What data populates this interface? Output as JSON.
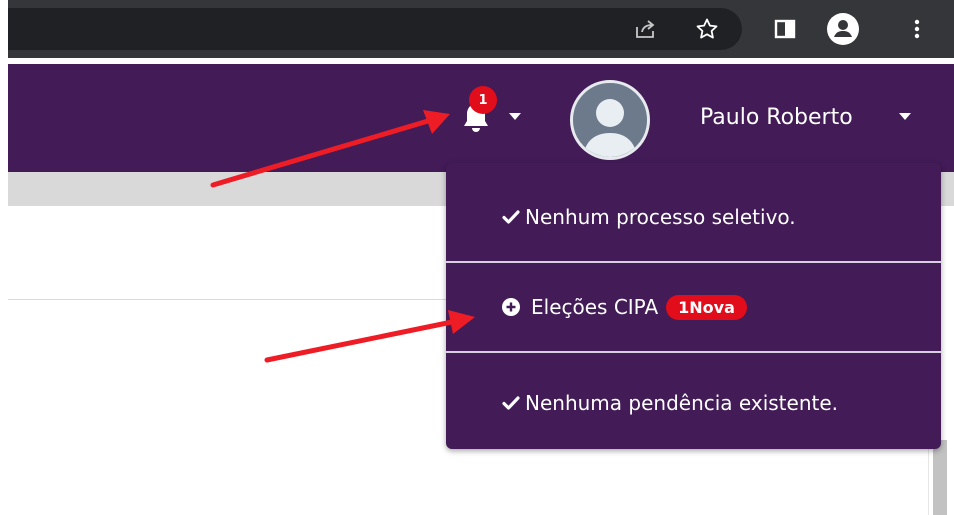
{
  "header": {
    "notification_count": "1",
    "user_name": "Paulo Roberto"
  },
  "notifications_menu": {
    "items": [
      {
        "icon": "check-icon",
        "label": "Nenhum processo seletivo."
      },
      {
        "icon": "plus-circle-icon",
        "label": "Eleções CIPA",
        "badge": "1Nova"
      },
      {
        "icon": "check-icon",
        "label": "Nenhuma pendência existente."
      }
    ]
  },
  "colors": {
    "appbar": "#421b57",
    "badge": "#e10d1a",
    "annotation_arrow": "#ee1c25"
  },
  "browser_toolbar": {
    "icons": [
      "share-icon",
      "star-icon",
      "side-panel-icon",
      "profile-icon",
      "kebab-menu-icon"
    ]
  }
}
